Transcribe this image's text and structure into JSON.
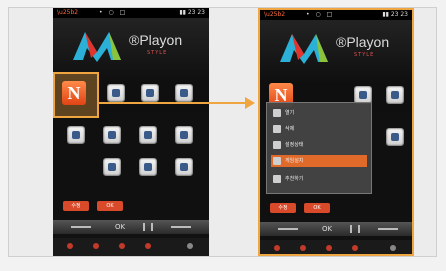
{
  "brand": {
    "logo_text": "®Playon",
    "logo_sub": "STYLE"
  },
  "status": {
    "center": "• ○ □",
    "time": "▮▮ 23 23"
  },
  "softkeys": {
    "left": "수정",
    "right": "OK"
  },
  "navbar": {
    "ok_label": "OK"
  },
  "tile_label": "N",
  "popup_items": [
    {
      "label": "열기"
    },
    {
      "label": "삭제"
    },
    {
      "label": "설정상태"
    },
    {
      "label": "게임설치"
    },
    {
      "label": "추천하기"
    }
  ],
  "colors": {
    "accent": "#f0a640",
    "brand_red": "#e04414"
  }
}
